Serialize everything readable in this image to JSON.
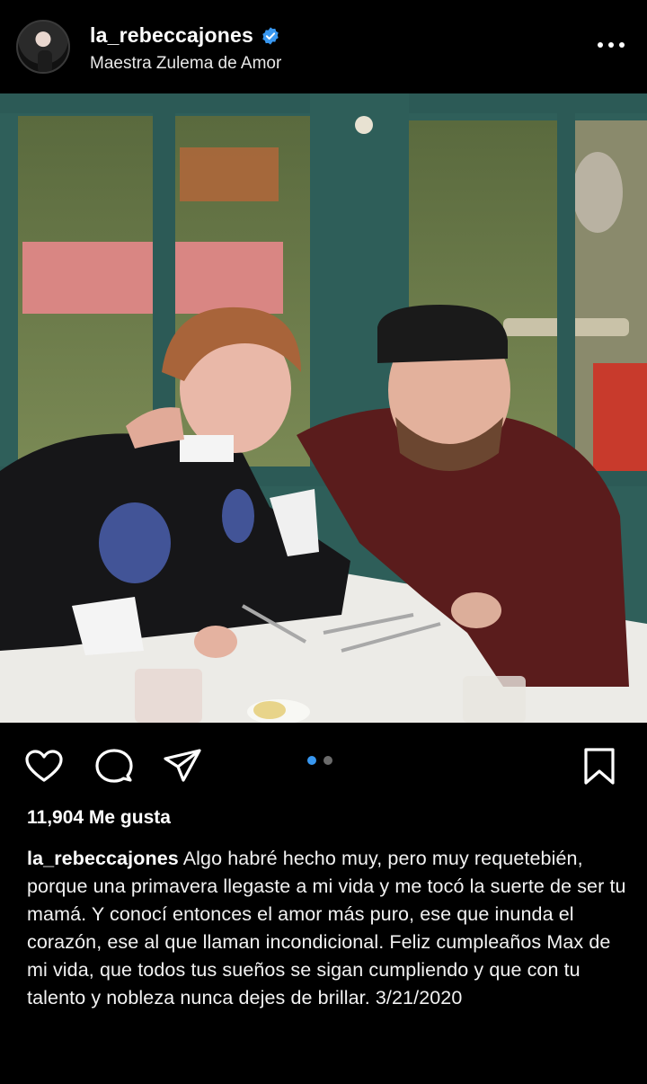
{
  "header": {
    "username": "la_rebeccajones",
    "subtitle": "Maestra Zulema de Amor",
    "verified": true
  },
  "post": {
    "carousel": {
      "count": 2,
      "active": 1
    },
    "likes": "11,904 Me gusta",
    "caption_user": "la_rebeccajones",
    "caption_text": "Algo habré hecho muy, pero muy requetebién, porque una primavera llegaste a mi vida y me tocó la suerte de ser tu mamá. Y conocí entonces el amor más puro, ese que inunda el corazón, ese al que llaman incondicional. Feliz cumpleaños Max de mi vida, que todos tus sueños se sigan cumpliendo y que con tu talento y nobleza nunca dejes de brillar. 3/21/2020"
  },
  "icons": [
    "more-options-icon",
    "heart-icon",
    "comment-icon",
    "share-icon",
    "bookmark-icon",
    "verified-badge-icon"
  ],
  "colors": {
    "background": "#000000",
    "text": "#ffffff",
    "accent": "#3897f0",
    "dot_inactive": "#6b6b6b"
  }
}
